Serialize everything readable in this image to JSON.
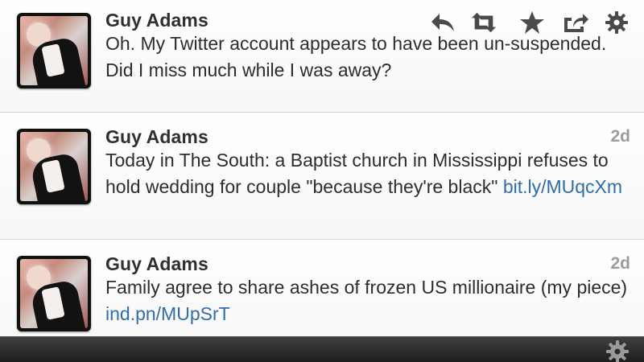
{
  "timeline": {
    "tweets": [
      {
        "user": "Guy Adams",
        "time": "",
        "text": "Oh. My Twitter account appears to have been un-suspended. Did I miss much while I was away?",
        "link": ""
      },
      {
        "user": "Guy Adams",
        "time": "2d",
        "text": "Today in The South: a Baptist church in Mississippi refuses to hold wedding for couple \"because they're black\" ",
        "link": "bit.ly/MUqcXm"
      },
      {
        "user": "Guy Adams",
        "time": "2d",
        "text": "Family agree to share ashes of frozen US millionaire (my piece) ",
        "link": "ind.pn/MUpSrT"
      }
    ]
  },
  "actions": {
    "icons": [
      "reply-icon",
      "retweet-icon",
      "favorite-star-icon",
      "share-icon",
      "gear-icon"
    ]
  },
  "bottom_bar": {
    "icon": "gear-icon"
  },
  "colors": {
    "name": "#303030",
    "text": "#2d2d2d",
    "link": "#2f6ea8",
    "time": "#9b9b9b",
    "bar": "#2b2b2b"
  }
}
